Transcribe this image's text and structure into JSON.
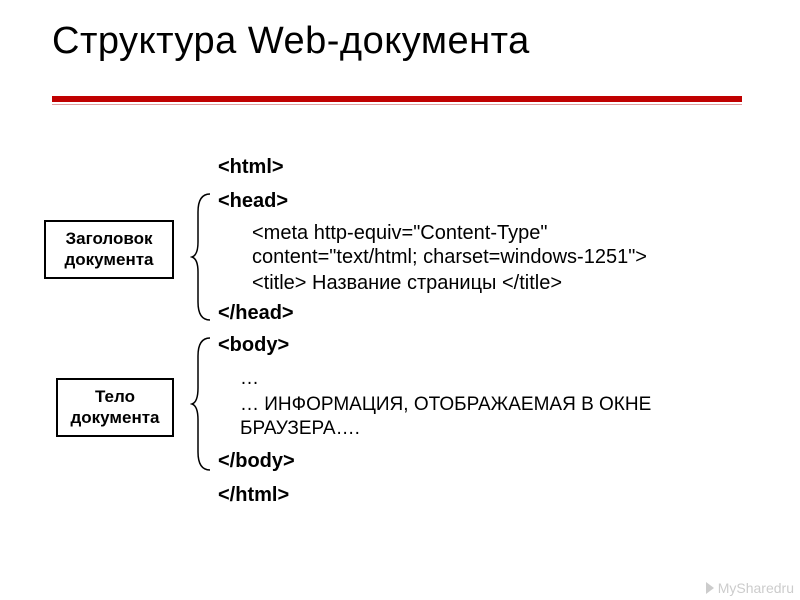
{
  "title": "Структура Web-документа",
  "labels": {
    "header_box": "Заголовок документа",
    "body_box": "Тело документа"
  },
  "code": {
    "html_open": "<html>",
    "head_open": "<head>",
    "meta_line1": "<meta http-equiv=\"Content-Type\"",
    "meta_line2": "content=\"text/html; charset=windows-1251\">",
    "title_line": "<title> Название страницы </title>",
    "head_close": "</head>",
    "body_open": "<body>",
    "body_content1": "…",
    "body_content2": "… ИНФОРМАЦИЯ, ОТОБРАЖАЕМАЯ В ОКНЕ",
    "body_content3": "БРАУЗЕРА….",
    "body_close": "</body>",
    "html_close": "</html>"
  },
  "watermark": "MySharedru"
}
